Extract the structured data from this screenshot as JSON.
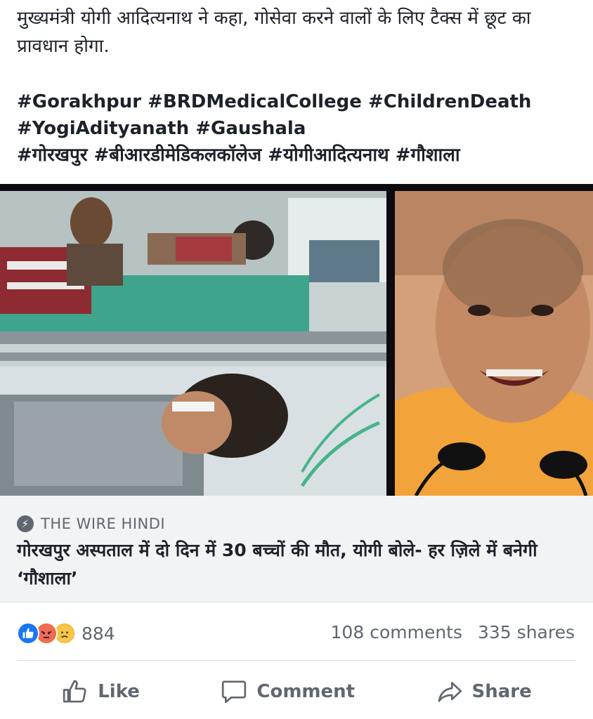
{
  "post": {
    "text_line1": "मुख्यमंत्री योगी आदित्यनाथ ने कहा, गोसेवा करने वालों के लिए टैक्स में छूट का",
    "text_line2": "प्रावधान होगा.",
    "hashtags_line1": "#Gorakhpur #BRDMedicalCollege #ChildrenDeath",
    "hashtags_line2": "#YogiAdityanath #Gaushala",
    "hashtags_line3": "#गोरखपुर #बीआरडीमेडिकलकॉलेज #योगीआदित्यनाथ #गौशाला"
  },
  "link_card": {
    "source": "THE WIRE HINDI",
    "headline": "गोरखपुर अस्पताल में दो दिन में 30 बच्चों की मौत, योगी बोले- हर ज़िले में बनेगी ‘गौशाला’"
  },
  "stats": {
    "reaction_count": "884",
    "comments": "108 comments",
    "shares": "335 shares",
    "reaction_icons": [
      "like-icon",
      "angry-icon",
      "sad-icon"
    ]
  },
  "actions": {
    "like": "Like",
    "comment": "Comment",
    "share": "Share"
  },
  "colors": {
    "text": "#1d2129",
    "muted": "#606770",
    "card_bg": "#f2f3f5",
    "like_blue": "#1877f2",
    "angry": "#e9710f",
    "sad": "#f7b125"
  }
}
